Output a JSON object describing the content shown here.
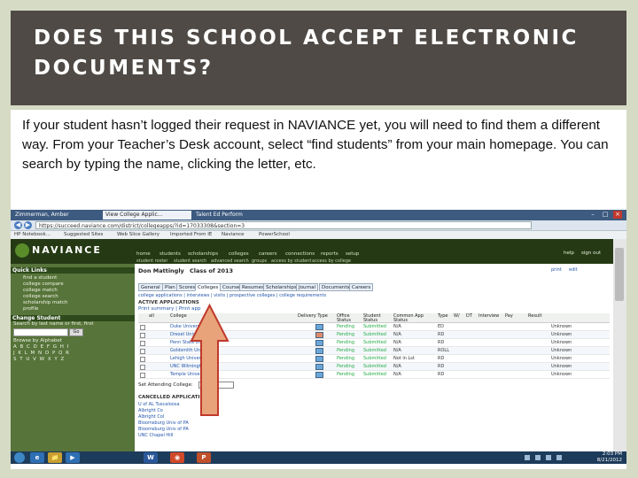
{
  "slide": {
    "title": "DOES THIS SCHOOL ACCEPT ELECTRONIC DOCUMENTS?",
    "body": "If your student hasn’t logged their request in NAVIANCE yet, you will need to find them a different way.  From your Teacher’s Desk account, select “find students” from your main homepage.  You can search by typing the name, clicking the letter, etc."
  },
  "browser": {
    "tabs": [
      "Zimmerman, Amber",
      "View College Applic...",
      "Talent Ed Perform"
    ],
    "window_controls": [
      "–",
      "□",
      "×"
    ],
    "url": "https://succeed.naviance.com/district/collegeapps/?id=17033308&section=3",
    "nav_back": "◀",
    "nav_forward": "▶",
    "bookmarks": [
      "HP Notebook...",
      "Suggested Sites",
      "Web Slice Gallery",
      "Imported From IE",
      "Naviance",
      "PowerSchool"
    ]
  },
  "naviance": {
    "logo": "NAVIANCE",
    "nav": [
      "home",
      "students",
      "scholarships",
      "colleges",
      "careers",
      "connections",
      "reports",
      "setup"
    ],
    "subnav": [
      "student roster",
      "student search",
      "advanced search",
      "groups",
      "access by student",
      "access by college"
    ],
    "top_links": [
      "help",
      "sign out"
    ],
    "sidebar": {
      "quick_links_title": "Quick Links",
      "quick_links": [
        "find a student",
        "college compare",
        "college match",
        "college search",
        "scholarship match",
        "profile"
      ],
      "change_student_title": "Change Student",
      "search_label": "Search by last name or first, first",
      "go": "Go",
      "browse_label": "Browse by Alphabet",
      "alphabet": [
        "A B C D E F G H I",
        "J K L M N O P Q R",
        "S T U V W X Y Z"
      ]
    },
    "student": {
      "name": "Don Mattingly",
      "class": "Class of 2013",
      "tools": [
        "print",
        "edit"
      ]
    },
    "profile_tabs": [
      "General",
      "Plan",
      "Scores",
      "Colleges",
      "Courses",
      "Resumes",
      "Scholarships",
      "Journal",
      "Documents",
      "Careers"
    ],
    "subtabs": "college applications | interviews | visits | prospective colleges | college requirements",
    "active_applications_title": "ACTIVE APPLICATIONS",
    "print_summary": "Print summary | Print app",
    "columns": [
      "all",
      "College",
      "Delivery Type",
      "Office Status",
      "Student Status",
      "Common App Status",
      "Type",
      "W/",
      "DT",
      "Interview",
      "Pay",
      "Result"
    ],
    "applications": [
      {
        "college": "Duke University",
        "office": "Pending",
        "student": "Submitted",
        "common": "N/A",
        "type": "ED",
        "result": "Unknown"
      },
      {
        "college": "Drexel University",
        "office": "Pending",
        "student": "Submitted",
        "common": "N/A",
        "type": "RD",
        "result": "Unknown"
      },
      {
        "college": "Penn State Univ of PA",
        "office": "Pending",
        "student": "Submitted",
        "common": "N/A",
        "type": "RD",
        "result": "Unknown"
      },
      {
        "college": "Goldsmith Univ",
        "office": "Pending",
        "student": "Submitted",
        "common": "N/A",
        "type": "ROLL",
        "result": "Unknown"
      },
      {
        "college": "Lehigh University",
        "office": "Pending",
        "student": "Submitted",
        "common": "Not in Lst",
        "type": "RD",
        "result": "Unknown"
      },
      {
        "college": "UNC Wilmington",
        "office": "Pending",
        "student": "Submitted",
        "common": "N/A",
        "type": "RD",
        "result": "Unknown"
      },
      {
        "college": "Temple University",
        "office": "Pending",
        "student": "Submitted",
        "common": "N/A",
        "type": "RD",
        "result": "Unknown"
      },
      {
        "college": "West Chester Univ of PA",
        "office": "Pending",
        "student": "Submitted",
        "common": "N/A",
        "type": "RD",
        "result": "Unknown"
      }
    ],
    "attending_label": "Set Attending College:",
    "attending_value": "N/A",
    "cancelled_title": "CANCELLED APPLICATIONS",
    "cancelled": [
      "U of AL Tuscaloosa",
      "Albright Co",
      "Albright Col",
      "Bloomsburg Univ of PA",
      "Bloomsburg Univ of PA",
      "UNC Chapel Hill"
    ]
  },
  "taskbar": {
    "apps": [
      "e",
      "📁",
      "▶",
      "W",
      "◉",
      "P"
    ],
    "time": "2:03 PM",
    "date": "8/21/2012"
  },
  "colors": {
    "header_bg": "#4f4a45",
    "slide_bg": "#d6dbc5",
    "arrow_fill": "#e9a37a",
    "arrow_stroke": "#c0392b"
  }
}
